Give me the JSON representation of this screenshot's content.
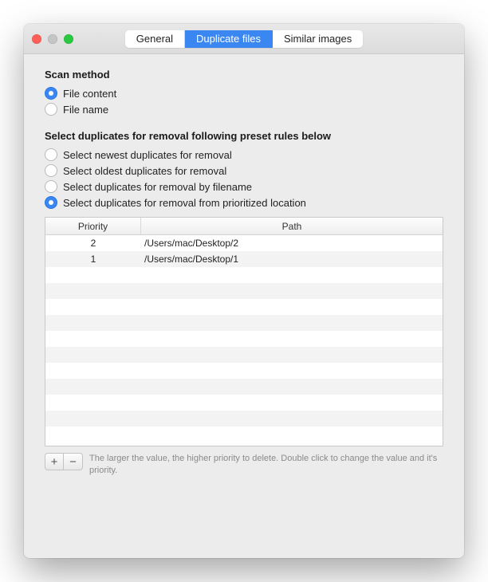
{
  "tabs": {
    "general": "General",
    "duplicate_files": "Duplicate files",
    "similar_images": "Similar images"
  },
  "scan_method": {
    "title": "Scan method",
    "file_content": "File content",
    "file_name": "File name"
  },
  "rules": {
    "title": "Select duplicates for removal following preset rules below",
    "newest": "Select newest duplicates for removal",
    "oldest": "Select oldest duplicates for removal",
    "filename": "Select duplicates for removal by filename",
    "prioritized": "Select duplicates for removal from prioritized location"
  },
  "table": {
    "col_priority": "Priority",
    "col_path": "Path",
    "rows": [
      {
        "priority": "2",
        "path": "/Users/mac/Desktop/2"
      },
      {
        "priority": "1",
        "path": "/Users/mac/Desktop/1"
      }
    ]
  },
  "buttons": {
    "add": "+",
    "remove": "−"
  },
  "hint": "The larger the value, the higher priority to delete. Double click to change the value and it's priority."
}
